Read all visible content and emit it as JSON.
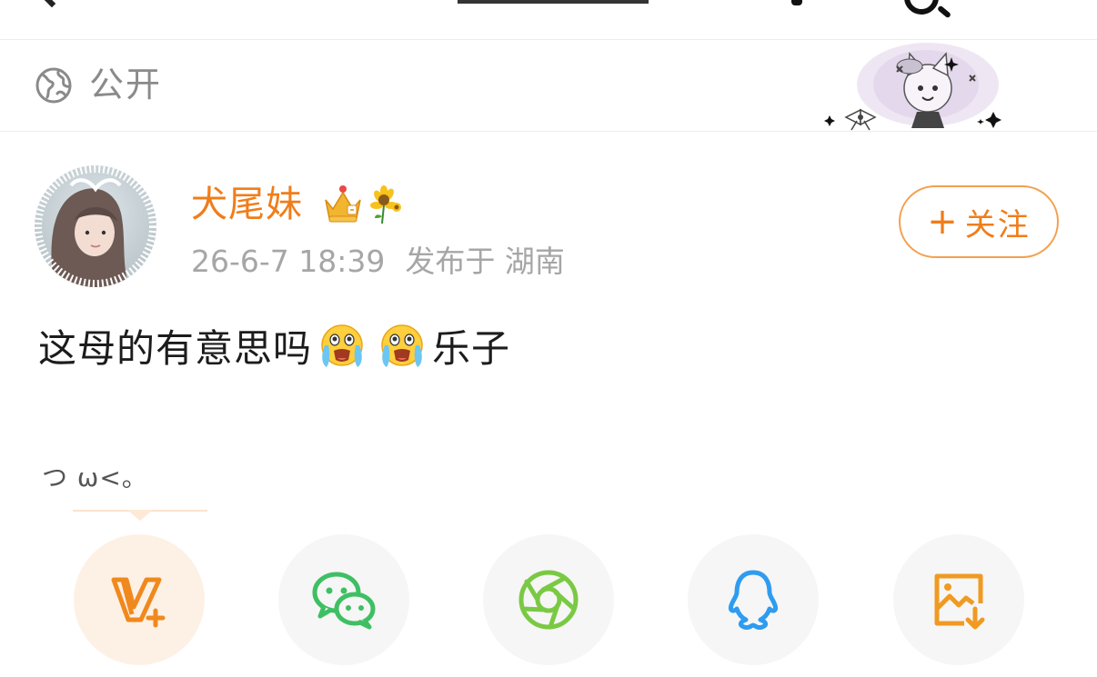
{
  "visibility": {
    "label": "公开",
    "icon": "globe-icon"
  },
  "post": {
    "username": "犬尾妹",
    "badges": [
      "crown-icon",
      "sunflower-icon"
    ],
    "time": "26-6-7 18:39",
    "location": "发布于 湖南",
    "follow_label": "关注",
    "text_part1": "这母的有意思吗",
    "text_part2": "乐子",
    "emojis": [
      "crying-emoji",
      "crying-emoji"
    ],
    "kaomoji": "つ ω<。"
  },
  "share": {
    "items": [
      {
        "icon": "vplus-icon"
      },
      {
        "icon": "wechat-icon"
      },
      {
        "icon": "moments-icon"
      },
      {
        "icon": "qq-icon"
      },
      {
        "icon": "save-image-icon"
      }
    ]
  },
  "colors": {
    "accent": "#f07d1a",
    "follow_border": "#f3a04f",
    "meta_gray": "#a6a6a6",
    "wechat_green": "#3fbf63",
    "moments_green": "#7ac943",
    "qq_blue": "#2e9cf0"
  }
}
